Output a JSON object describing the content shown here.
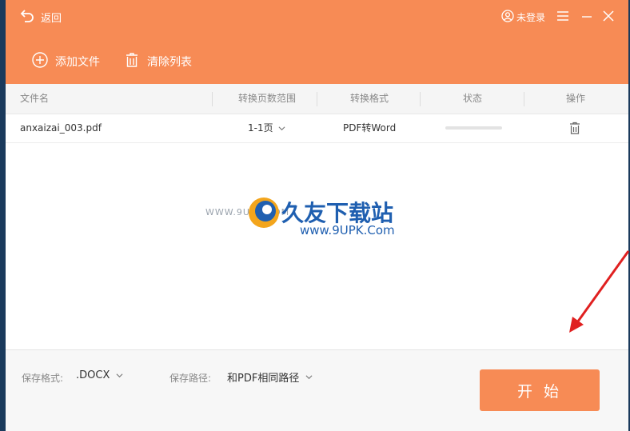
{
  "header": {
    "back_label": "返回",
    "user_label": "未登录",
    "add_file_label": "添加文件",
    "clear_list_label": "清除列表"
  },
  "table": {
    "columns": [
      "文件名",
      "转换页数范围",
      "转换格式",
      "状态",
      "操作"
    ],
    "rows": [
      {
        "filename": "anxaizai_003.pdf",
        "page_range": "1-1页",
        "format": "PDF转Word",
        "progress": 0
      }
    ]
  },
  "watermark": {
    "title": "久友下载站",
    "url_left": "WWW.9UPK.COM",
    "url_right": "www.9UPK.Com"
  },
  "footer": {
    "save_format_label": "保存格式:",
    "save_format_value": ".DOCX",
    "save_path_label": "保存路径:",
    "save_path_value": "和PDF相同路径",
    "start_label": "开 始"
  },
  "colors": {
    "accent": "#f78b55",
    "header_text": "#ffffff",
    "annotation_arrow": "#e02020"
  }
}
